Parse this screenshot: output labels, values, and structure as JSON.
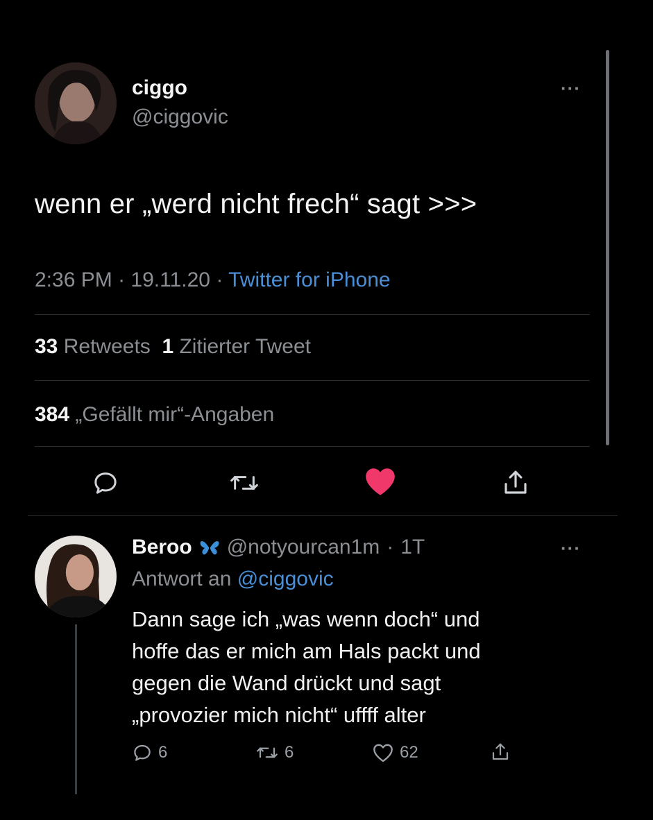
{
  "main_tweet": {
    "name": "ciggo",
    "handle": "@ciggovic",
    "more": "···",
    "text": "wenn er „werd nicht frech“ sagt >>>",
    "time": "2:36 PM",
    "date": "19.11.20",
    "separator": "·",
    "source": "Twitter for iPhone",
    "retweets_count": "33",
    "retweets_label": "Retweets",
    "quotes_count": "1",
    "quotes_label": "Zitierter Tweet",
    "likes_count": "384",
    "likes_label": "„Gefällt mir“-Angaben",
    "liked": true,
    "like_color": "#f0386b"
  },
  "reply": {
    "name": "Beroo",
    "handle": "@notyourcan1m",
    "age": "1T",
    "more": "···",
    "reply_to_label": "Antwort an",
    "reply_to_handle": "@ciggovic",
    "text_lines": [
      "Dann sage ich „was wenn doch“ und",
      "hoffe das er mich am Hals packt und",
      "gegen die Wand drückt und sagt",
      "„provozier mich nicht“ uffff alter"
    ],
    "replies": "6",
    "retweets": "6",
    "likes": "62"
  },
  "colors": {
    "link": "#4a8fd6",
    "muted": "#8b8f94",
    "background": "#000000"
  }
}
